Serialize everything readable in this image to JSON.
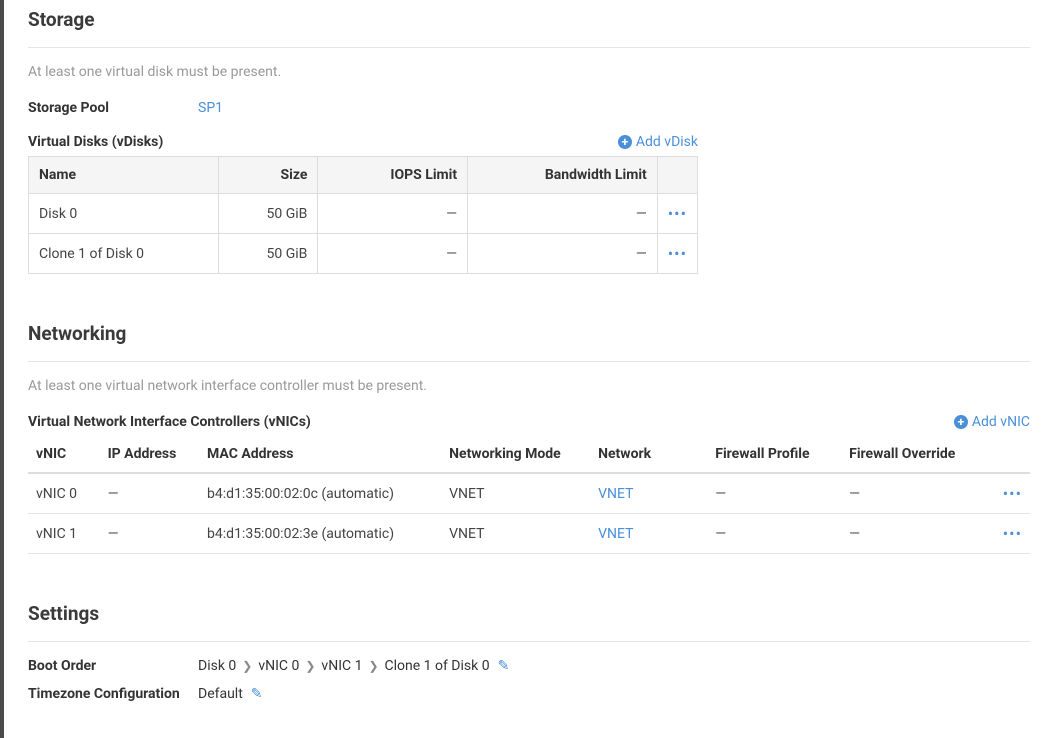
{
  "storage": {
    "title": "Storage",
    "hint": "At least one virtual disk must be present.",
    "pool_label": "Storage Pool",
    "pool_value": "SP1",
    "vdisks_label": "Virtual Disks (vDisks)",
    "add_vdisk_label": "Add vDisk",
    "columns": {
      "name": "Name",
      "size": "Size",
      "iops": "IOPS Limit",
      "bandwidth": "Bandwidth Limit"
    },
    "rows": [
      {
        "name": "Disk 0",
        "size": "50 GiB",
        "iops": "—",
        "bandwidth": "—"
      },
      {
        "name": "Clone 1 of Disk 0",
        "size": "50 GiB",
        "iops": "—",
        "bandwidth": "—"
      }
    ]
  },
  "networking": {
    "title": "Networking",
    "hint": "At least one virtual network interface controller must be present.",
    "vnics_label": "Virtual Network Interface Controllers (vNICs)",
    "add_vnic_label": "Add vNIC",
    "columns": {
      "vnic": "vNIC",
      "ip": "IP Address",
      "mac": "MAC Address",
      "mode": "Networking Mode",
      "network": "Network",
      "firewall": "Firewall Profile",
      "override": "Firewall Override"
    },
    "rows": [
      {
        "vnic": "vNIC 0",
        "ip": "—",
        "mac": "b4:d1:35:00:02:0c (automatic)",
        "mode": "VNET",
        "network": "VNET",
        "firewall": "—",
        "override": "—"
      },
      {
        "vnic": "vNIC 1",
        "ip": "—",
        "mac": "b4:d1:35:00:02:3e (automatic)",
        "mode": "VNET",
        "network": "VNET",
        "firewall": "—",
        "override": "—"
      }
    ]
  },
  "settings": {
    "title": "Settings",
    "boot_order_label": "Boot Order",
    "boot_order": [
      "Disk 0",
      "vNIC 0",
      "vNIC 1",
      "Clone 1 of Disk 0"
    ],
    "timezone_label": "Timezone Configuration",
    "timezone_value": "Default"
  }
}
